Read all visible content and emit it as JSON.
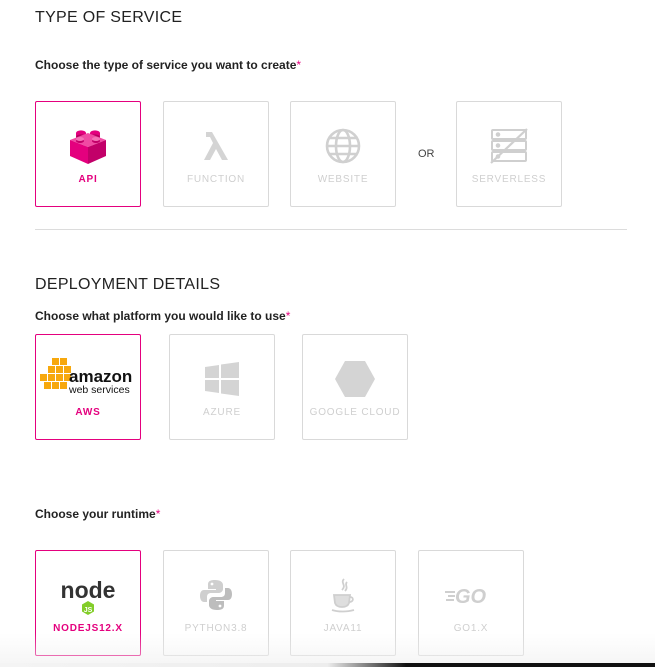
{
  "service": {
    "title": "TYPE OF SERVICE",
    "question": "Choose the type of service you want to create",
    "required_mark": "*",
    "options": [
      {
        "label": "API",
        "icon": "lego-block-icon",
        "selected": true
      },
      {
        "label": "FUNCTION",
        "icon": "lambda-icon",
        "selected": false
      },
      {
        "label": "WEBSITE",
        "icon": "globe-icon",
        "selected": false
      }
    ],
    "or_label": "OR",
    "alt_option": {
      "label": "SERVERLESS",
      "icon": "serverless-icon",
      "selected": false
    }
  },
  "deployment": {
    "title": "DEPLOYMENT DETAILS",
    "platform_question": "Choose what platform you would like to use",
    "required_mark": "*",
    "platforms": [
      {
        "label": "AWS",
        "icon": "aws-logo-icon",
        "logo_text_1": "amazon",
        "logo_text_2": "web services",
        "selected": true
      },
      {
        "label": "AZURE",
        "icon": "windows-icon",
        "selected": false
      },
      {
        "label": "GOOGLE CLOUD",
        "icon": "hexagon-icon",
        "selected": false
      }
    ],
    "runtime_question": "Choose your runtime",
    "runtimes": [
      {
        "label": "NODEJS12.X",
        "icon": "nodejs-logo-icon",
        "logo_text": "node",
        "selected": true
      },
      {
        "label": "PYTHON3.8",
        "icon": "python-icon",
        "selected": false
      },
      {
        "label": "JAVA11",
        "icon": "java-icon",
        "selected": false
      },
      {
        "label": "GO1.X",
        "icon": "go-logo-icon",
        "logo_text": "GO",
        "selected": false
      }
    ]
  },
  "colors": {
    "accent": "#e4007e",
    "disabled": "#cfcfcf",
    "aws_orange": "#f7a80d",
    "node_green": "#83cd29"
  }
}
